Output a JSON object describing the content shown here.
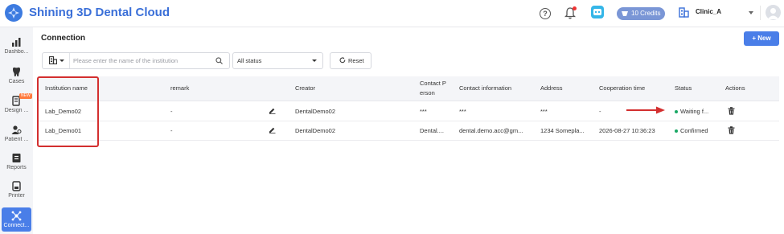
{
  "header": {
    "app_title": "Shining 3D Dental Cloud",
    "help_icon_glyph": "?",
    "credits_label": "10 Credits",
    "clinic_name": "Clinic_A"
  },
  "sidebar": {
    "items": [
      {
        "label": "Dashbo...",
        "icon": "bar-chart-icon"
      },
      {
        "label": "Cases",
        "icon": "tooth-icon"
      },
      {
        "label": "Design ...",
        "icon": "design-icon",
        "badge": "NEW"
      },
      {
        "label": "Patient ...",
        "icon": "patient-icon"
      },
      {
        "label": "Reports",
        "icon": "report-icon"
      },
      {
        "label": "Printer",
        "icon": "printer-icon"
      },
      {
        "label": "Connect...",
        "icon": "connection-icon",
        "active": true
      }
    ]
  },
  "main": {
    "page_title": "Connection",
    "new_button_label": "+ New",
    "search_placeholder": "Please enter the name of the institution",
    "status_filter_value": "All status",
    "reset_label": "Reset",
    "table": {
      "columns": [
        "Institution name",
        "remark",
        "Creator",
        "Contact P",
        "erson",
        "Contact information",
        "Address",
        "Cooperation time",
        "Status",
        "Actions"
      ],
      "rows": [
        {
          "institution": "Lab_Demo02",
          "remark": "-",
          "creator": "DentalDemo02",
          "contact_person": "***",
          "contact_info": "***",
          "address": "***",
          "cooperation_time": "-",
          "status": "Waiting f...",
          "status_color": "#1aa865"
        },
        {
          "institution": "Lab_Demo01",
          "remark": "-",
          "creator": "DentalDemo02",
          "contact_person": "Dental....",
          "contact_info": "dental.demo.acc@gm...",
          "address": "1234 Somepla...",
          "cooperation_time": "2026-08-27 10:36:23",
          "status": "Confirmed",
          "status_color": "#1aa865"
        }
      ]
    }
  },
  "colors": {
    "brand": "#3a6fd8",
    "primary_button": "#4a7ee8",
    "annotation_red": "#d32f2f",
    "status_green": "#1aa865"
  }
}
